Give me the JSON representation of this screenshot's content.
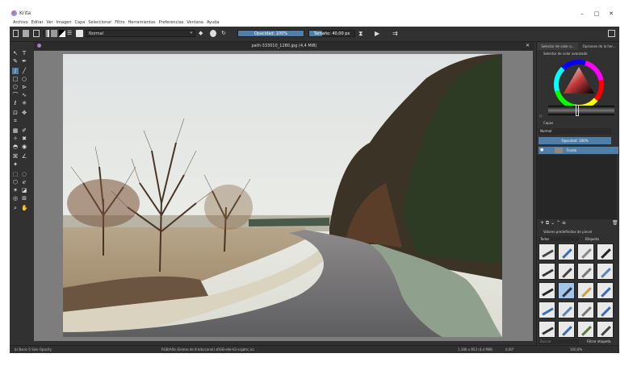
{
  "window": {
    "app_title": "Krita",
    "minimize": "–",
    "maximize": "□",
    "close": "✕"
  },
  "menu": [
    "Archivo",
    "Editar",
    "Ver",
    "Imagen",
    "Capa",
    "Seleccionar",
    "Filtro",
    "Herramientas",
    "Preferencias",
    "Ventana",
    "Ayuda"
  ],
  "toolbar": {
    "blend_mode": "Normal",
    "opacity": "Opacidad: 100%",
    "size": "Tamaño: 40,00 px"
  },
  "document_tab": "path-333010_1280.jpg (4,4 MiB)",
  "status": {
    "brush_preset": "b) Basic-5 Size Opacity",
    "color_info": "RGB/Alfa (Entero de 8 bits/canal)  sRGB-elle-V2-srgbtrc.icc",
    "image_size": "1.280 x 853 (4,4 MiB)",
    "rotation": "0,00°",
    "zoom": "100,0%"
  },
  "dock": {
    "tab_colors": "Selector de color a...",
    "tab_options": "Opciones de la her...",
    "color_panel_title": "Selector de color avanzado",
    "layers_title": "Capas",
    "layer_blend": "Normal",
    "layer_opacity": "Opacidad: 100%",
    "layer_name": "Fondo",
    "presets_title": "Valores predefinidos de pincel",
    "presets_filter": "Todos",
    "presets_tag_label": "Etiqueta",
    "search_placeholder": "Buscar",
    "filter_tag": "Filtrar etiqueta"
  },
  "colors": {
    "chrome": "#313131",
    "menubar": "#ffffff",
    "accent": "#4f7ea8",
    "canvas_bg": "#7d7d7d"
  }
}
